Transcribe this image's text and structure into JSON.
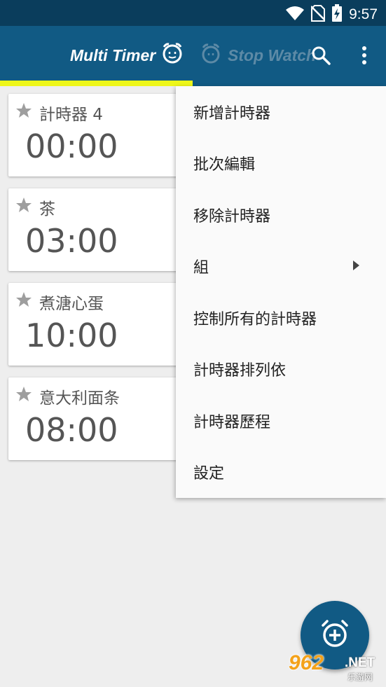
{
  "status_bar": {
    "time": "9:57",
    "icons": [
      "wifi-icon",
      "no-sim-icon",
      "battery-charging-icon"
    ]
  },
  "app_bar": {
    "tabs": [
      {
        "label": "Multi Timer",
        "icon": "alarm-clock-face-icon",
        "active": true
      },
      {
        "label": "Stop Watch",
        "icon": "stopwatch-icon",
        "active": false
      }
    ],
    "actions": [
      "search-icon",
      "more-vert-icon"
    ],
    "indicator_color": "#eef71a",
    "color": "#115a84"
  },
  "timers": [
    {
      "name": "計時器 4",
      "time": "00:00"
    },
    {
      "name": "茶",
      "time": "03:00"
    },
    {
      "name": "煮溏心蛋",
      "time": "10:00"
    },
    {
      "name": "意大利面条",
      "time": "08:00"
    }
  ],
  "menu": {
    "items": [
      {
        "label": "新增計時器"
      },
      {
        "label": "批次編輯"
      },
      {
        "label": "移除計時器"
      },
      {
        "label": "組",
        "submenu": true
      },
      {
        "label": "控制所有的計時器"
      },
      {
        "label": "計時器排列依"
      },
      {
        "label": "計時器歷程"
      },
      {
        "label": "設定"
      }
    ]
  },
  "fab": {
    "icon": "add-alarm-icon"
  },
  "watermark": {
    "logo": "962",
    "suffix": ".NET",
    "sub": "乐游网"
  }
}
